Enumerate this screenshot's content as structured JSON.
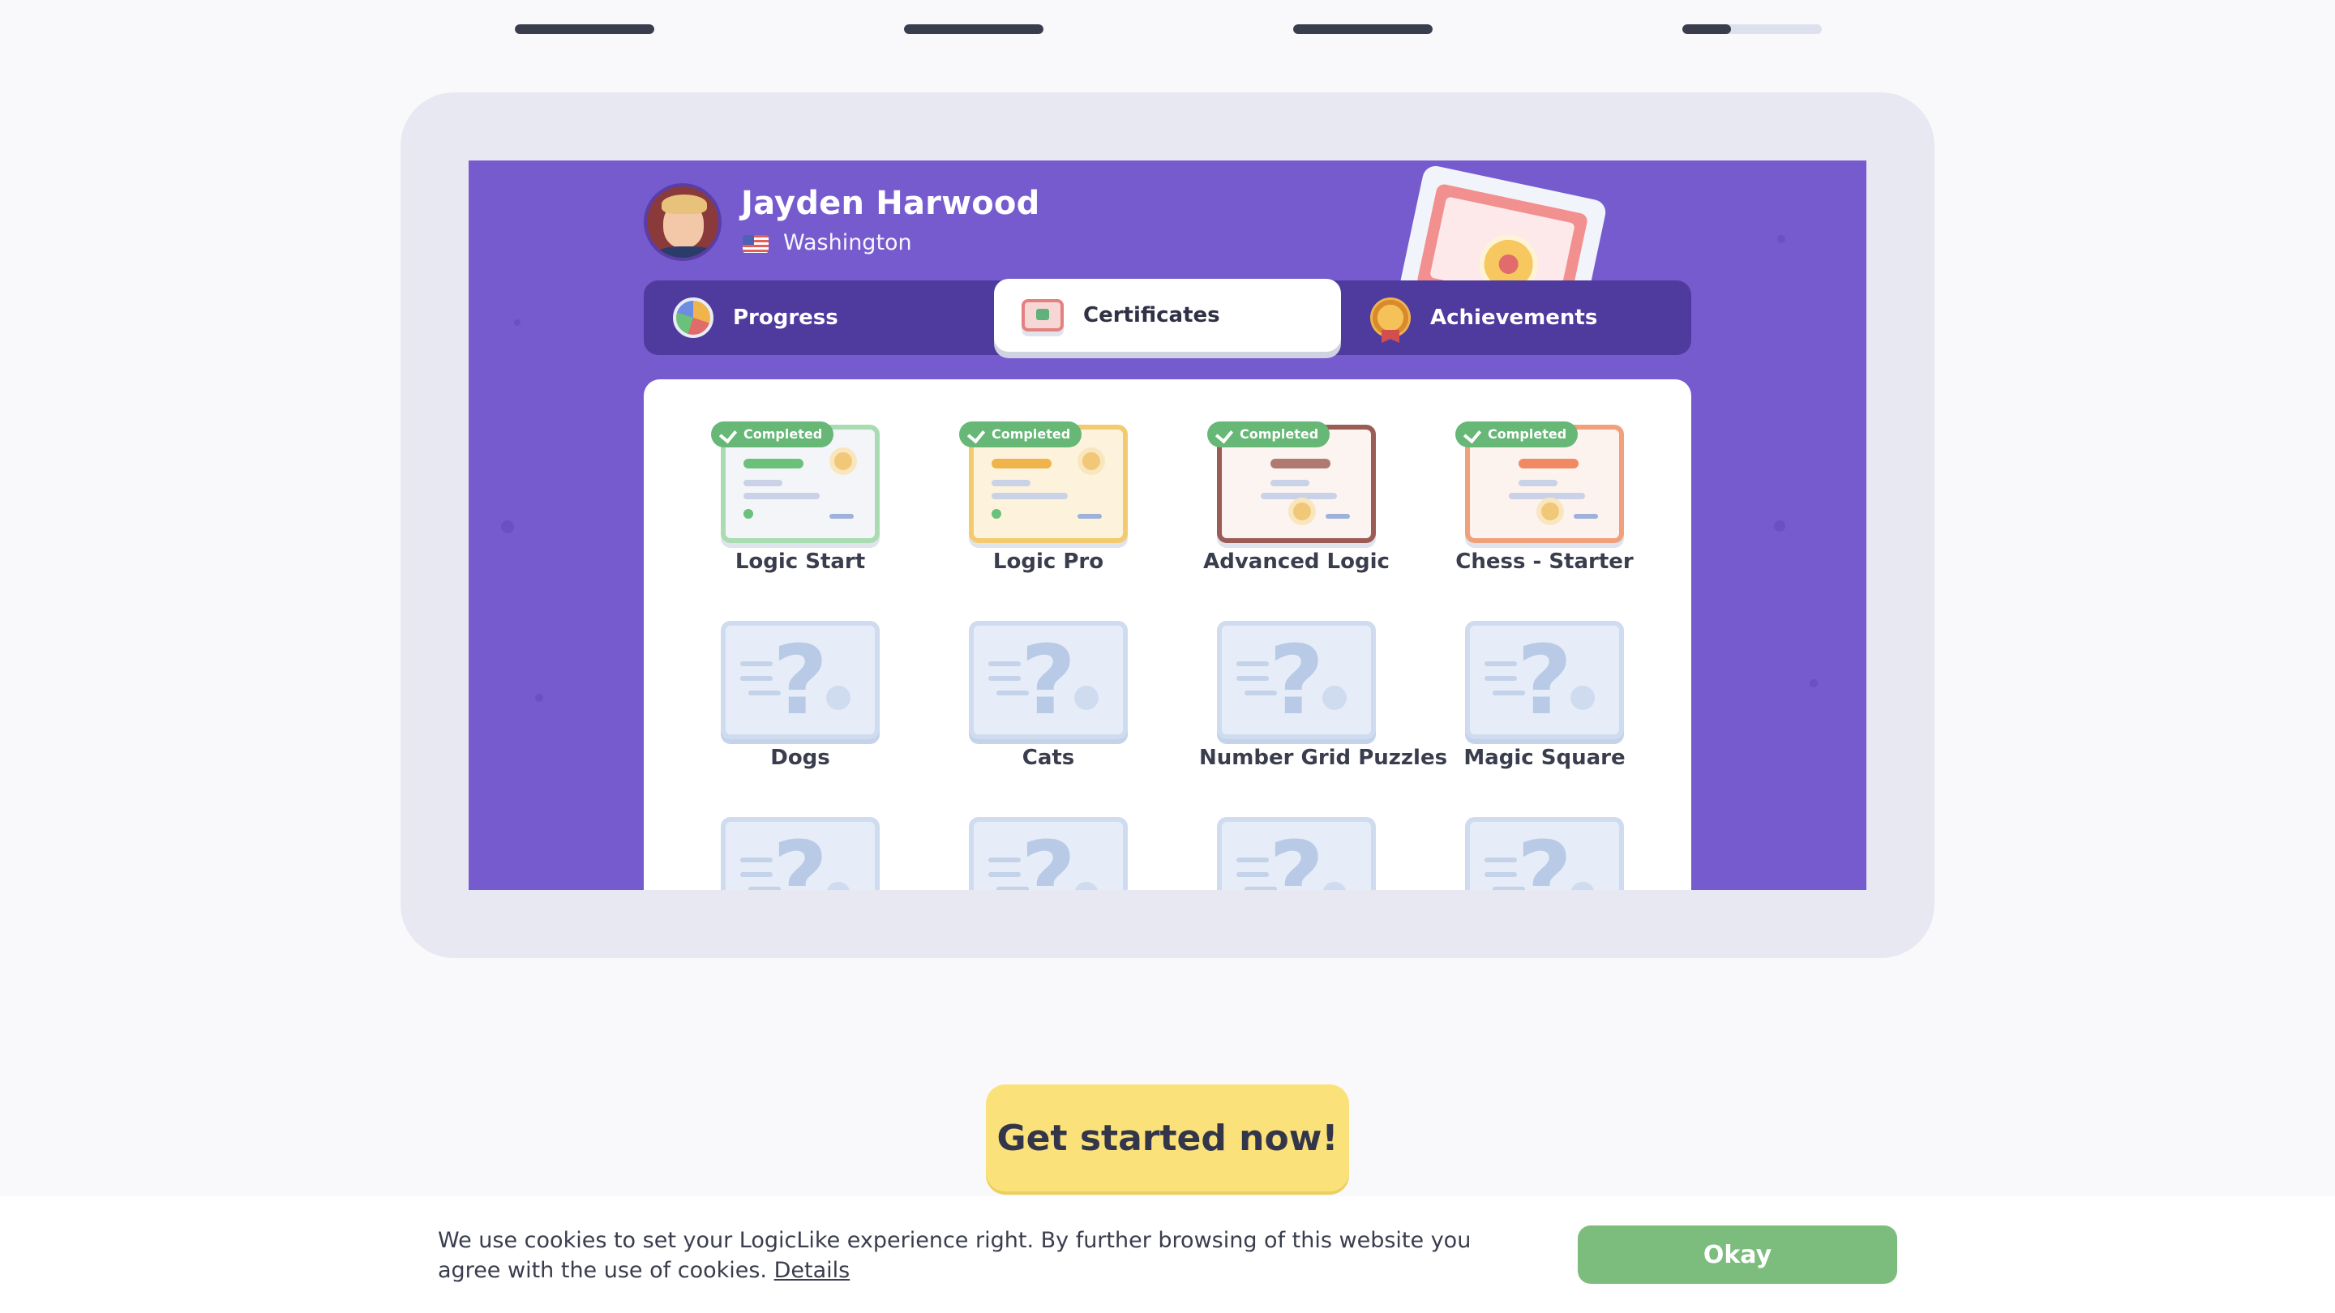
{
  "progress_steps": [
    {
      "fill": 1.0
    },
    {
      "fill": 1.0
    },
    {
      "fill": 1.0
    },
    {
      "fill": 0.35
    }
  ],
  "profile": {
    "name": "Jayden Harwood",
    "location": "Washington",
    "flag_icon": "us-flag-icon"
  },
  "tabs": [
    {
      "label": "Progress",
      "icon": "pie-chart-icon",
      "active": false
    },
    {
      "label": "Certificates",
      "icon": "certificate-icon",
      "active": true
    },
    {
      "label": "Achievements",
      "icon": "medal-icon",
      "active": false
    }
  ],
  "certificates": [
    {
      "title": "Logic Start",
      "status": "Completed",
      "accent": "#6bc07a"
    },
    {
      "title": "Logic Pro",
      "status": "Completed",
      "accent": "#f0b44c"
    },
    {
      "title": "Advanced Logic",
      "status": "Completed",
      "accent": "#a36b62"
    },
    {
      "title": "Chess - Starter",
      "status": "Completed",
      "accent": "#f08a64"
    },
    {
      "title": "Dogs",
      "status": "locked"
    },
    {
      "title": "Cats",
      "status": "locked"
    },
    {
      "title": "Number Grid Puzzles",
      "status": "locked"
    },
    {
      "title": "Magic Square",
      "status": "locked"
    },
    {
      "title": "",
      "status": "locked"
    },
    {
      "title": "",
      "status": "locked"
    },
    {
      "title": "",
      "status": "locked"
    },
    {
      "title": "",
      "status": "locked"
    }
  ],
  "cta": {
    "label": "Get started now!"
  },
  "cookie": {
    "text": "We use cookies to set your LogicLike experience right. By further browsing of this website you agree with the use of cookies.",
    "details_label": "Details",
    "okay_label": "Okay"
  },
  "colors": {
    "screen_bg": "#765bcf",
    "tabs_bg": "#4f3b9e",
    "completed_badge": "#67b776",
    "cta_bg": "#fbe17a",
    "okay_bg": "#7cbd7e"
  }
}
